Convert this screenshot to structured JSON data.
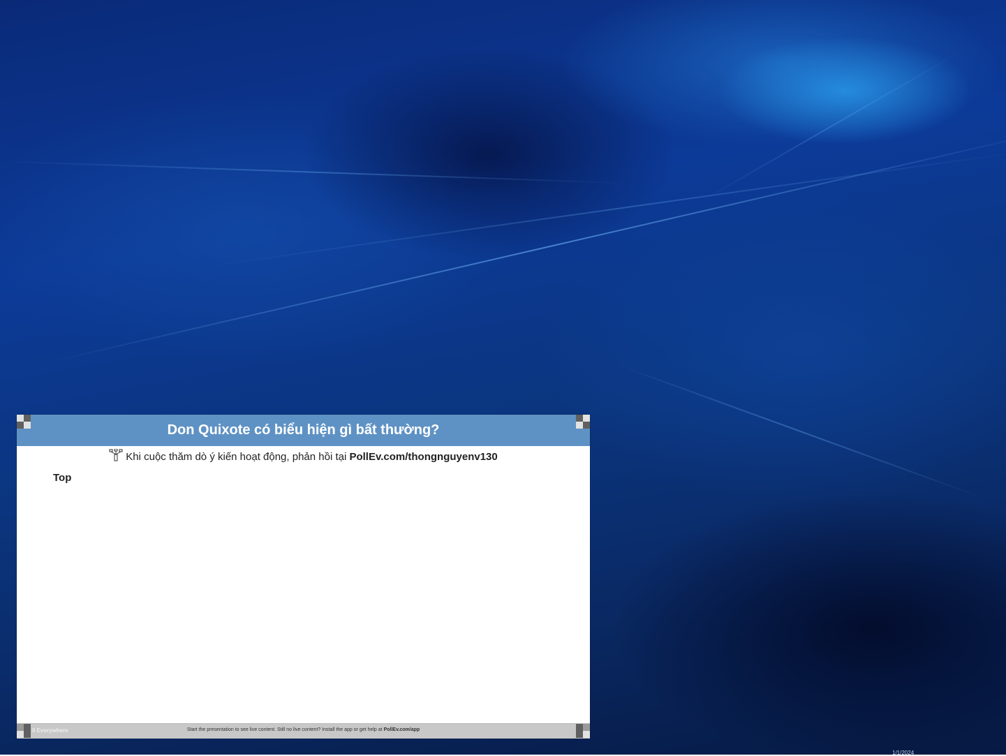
{
  "poll": {
    "title": "Don Quixote có biểu hiện gì bất thường?",
    "instruction_prefix": "Khi cuộc thăm dò ý kiến hoạt động, phản hồi tại ",
    "instruction_url": "PollEv.com/thongnguyenv130",
    "section_label": "Top",
    "footer_brand": "ll Everywhere",
    "footer_text": "Start the presentation to see live content. Still no live content? Install the app or get help at ",
    "footer_url": "PollEv.com/app",
    "header_color": "#5f92c4",
    "footer_color": "#c8c8c8"
  },
  "desktop": {
    "corner_text": "1/1/2024",
    "background_color": "#0b357e"
  },
  "icons": {
    "poll_icon": "poll-everywhere-icon",
    "resize_handle": "resize-handle-icon"
  }
}
